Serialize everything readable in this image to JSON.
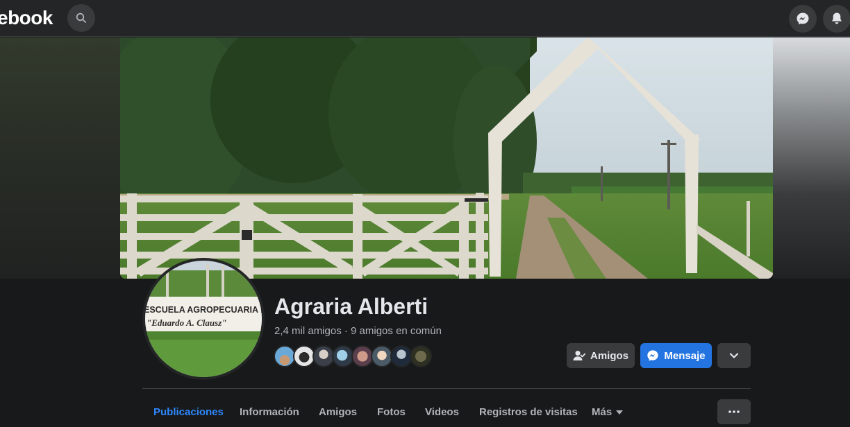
{
  "topbar": {
    "brand": "ebook",
    "icons": [
      "search-icon",
      "messenger-icon",
      "bell-icon"
    ]
  },
  "profile": {
    "name": "Agraria Alberti",
    "friends_summary": "2,4 mil amigos · 9 amigos en común",
    "avatar_sign_line1": "ESCUELA AGROPECUARIA N°",
    "avatar_sign_line2": "\"Eduardo A. Clausz\"",
    "mutual_friend_count_shown": 8
  },
  "actions": {
    "friends_label": "Amigos",
    "message_label": "Mensaje",
    "more_icon": "chevron-down-icon"
  },
  "tabs": [
    {
      "label": "Publicaciones",
      "active": true
    },
    {
      "label": "Información",
      "active": false
    },
    {
      "label": "Amigos",
      "active": false
    },
    {
      "label": "Fotos",
      "active": false
    },
    {
      "label": "Videos",
      "active": false
    },
    {
      "label": "Registros de visitas",
      "active": false
    },
    {
      "label": "Más",
      "active": false
    }
  ],
  "colors": {
    "background": "#18191a",
    "surface": "#242526",
    "button": "#3a3b3c",
    "accent": "#2374e1",
    "active_tab": "#2d88ff"
  }
}
